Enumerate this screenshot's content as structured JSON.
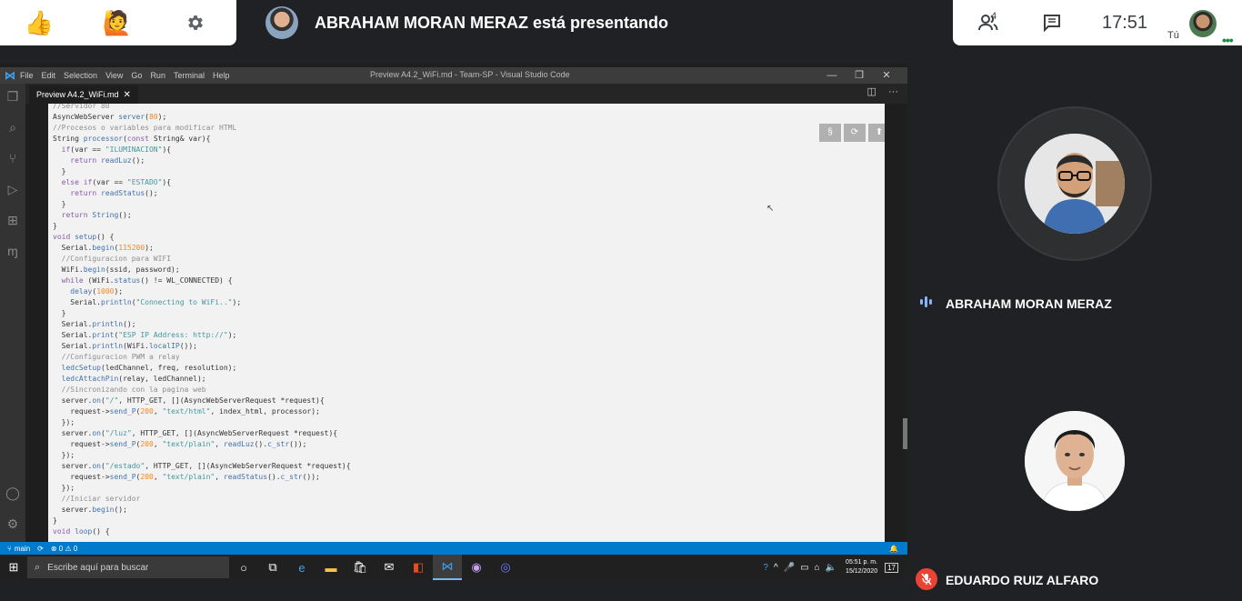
{
  "meet": {
    "presenter_text": "ABRAHAM MORAN MERAZ está presentando",
    "people_count": "4",
    "clock": "17:51",
    "you_label": "Tú",
    "icons": {
      "thumb": "thumbs-up-icon",
      "raise_hand": "raise-hand-icon",
      "settings": "gear-icon",
      "people": "people-icon",
      "chat": "chat-icon"
    }
  },
  "vscode": {
    "menu": [
      "File",
      "Edit",
      "Selection",
      "View",
      "Go",
      "Run",
      "Terminal",
      "Help"
    ],
    "window_title": "Preview A4.2_WiFi.md - Team-SP - Visual Studio Code",
    "tab_label": "Preview A4.2_WiFi.md",
    "tab_close": "✕",
    "status_branch": "main",
    "status_problems": "⊗ 0 ⚠ 0",
    "preview_buttons": [
      "§",
      "⟳",
      "⬆"
    ]
  },
  "taskbar": {
    "search_placeholder": "Escribe aquí para buscar",
    "time": "05:51 p. m.",
    "date": "15/12/2020",
    "notifications": "17"
  },
  "participants": [
    {
      "name": "ABRAHAM MORAN MERAZ",
      "status": "speaking"
    },
    {
      "name": "EDUARDO RUIZ ALFARO",
      "status": "muted"
    }
  ],
  "colors": {
    "meet_bg": "#202124",
    "accent_green": "#1e8e3e",
    "vscode_blue": "#007acc",
    "muted_red": "#ea4335"
  }
}
